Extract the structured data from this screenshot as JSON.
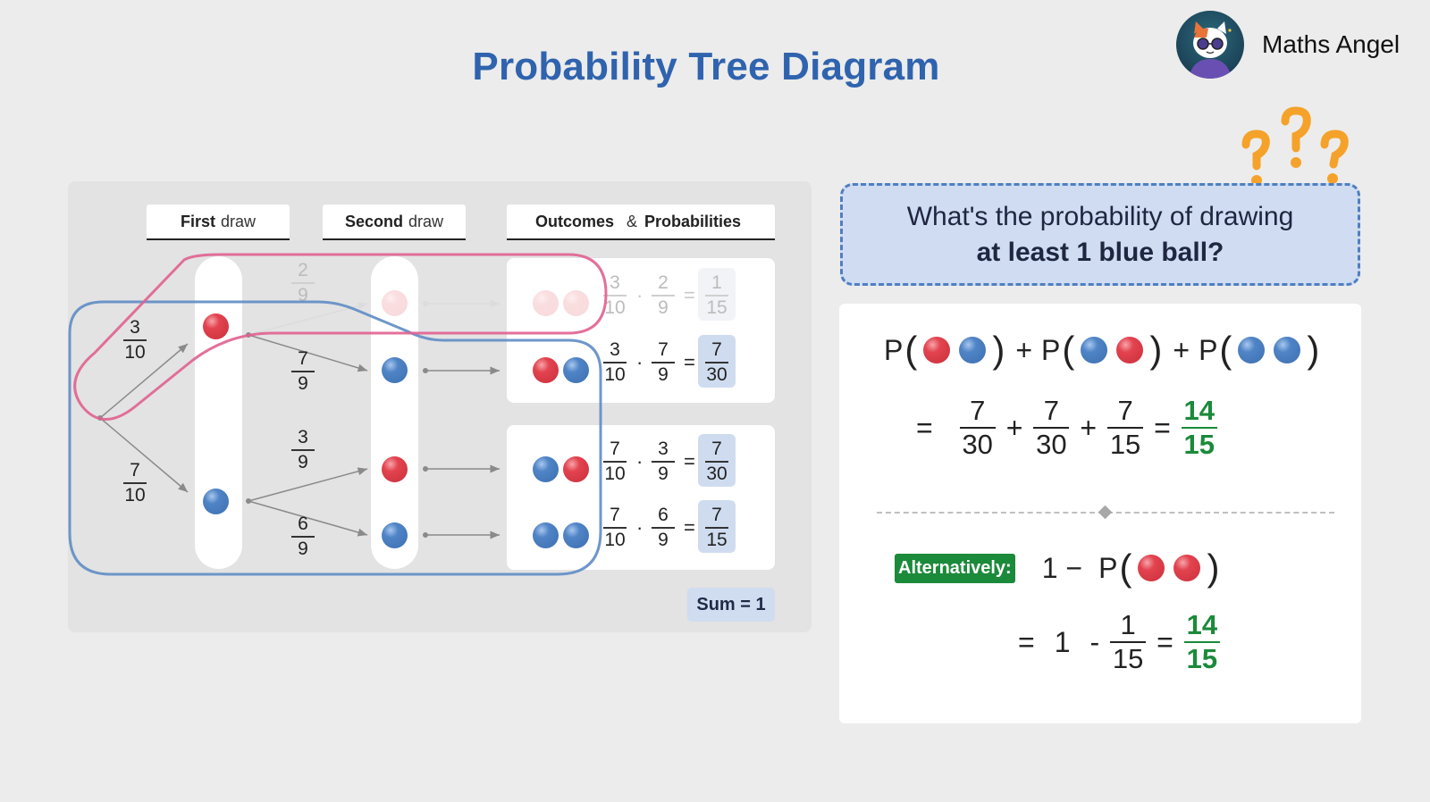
{
  "title": "Probability Tree Diagram",
  "brand": {
    "name": "Maths Angel",
    "logo_icon": "cat-with-sunglasses-avatar"
  },
  "decoration": {
    "icon": "question-marks-icon",
    "color": "#f5a22a"
  },
  "colors": {
    "accent_blue": "#2f63ae",
    "ball_red": "#e2434f",
    "ball_blue": "#4f84c6",
    "highlight_pink": "#e0608f",
    "highlight_blue": "#5e8cc4",
    "answer_green": "#1b8a3a",
    "result_bg": "#cfdcf0"
  },
  "tree": {
    "headers": [
      {
        "bold": "First",
        "rest": "draw"
      },
      {
        "bold": "Second",
        "rest": "draw"
      },
      {
        "bold": "Outcomes",
        "amp": "&",
        "bold2": "Probabilities"
      }
    ],
    "first_draw": [
      {
        "color": "red",
        "prob_num": "3",
        "prob_den": "10"
      },
      {
        "color": "blue",
        "prob_num": "7",
        "prob_den": "10"
      }
    ],
    "second_draw": [
      {
        "color": "red",
        "prob_num": "2",
        "prob_den": "9",
        "faded": true
      },
      {
        "color": "blue",
        "prob_num": "7",
        "prob_den": "9",
        "faded": false
      },
      {
        "color": "red",
        "prob_num": "3",
        "prob_den": "9",
        "faded": false
      },
      {
        "color": "blue",
        "prob_num": "6",
        "prob_den": "9",
        "faded": false
      }
    ],
    "outcomes": [
      {
        "balls": [
          "red",
          "red"
        ],
        "f1n": "3",
        "f1d": "10",
        "dot": "·",
        "f2n": "2",
        "f2d": "9",
        "eq": "=",
        "rn": "1",
        "rd": "15",
        "faded": true
      },
      {
        "balls": [
          "red",
          "blue"
        ],
        "f1n": "3",
        "f1d": "10",
        "dot": "·",
        "f2n": "7",
        "f2d": "9",
        "eq": "=",
        "rn": "7",
        "rd": "30",
        "faded": false
      },
      {
        "balls": [
          "blue",
          "red"
        ],
        "f1n": "7",
        "f1d": "10",
        "dot": "·",
        "f2n": "3",
        "f2d": "9",
        "eq": "=",
        "rn": "7",
        "rd": "30",
        "faded": false
      },
      {
        "balls": [
          "blue",
          "blue"
        ],
        "f1n": "7",
        "f1d": "10",
        "dot": "·",
        "f2n": "6",
        "f2d": "9",
        "eq": "=",
        "rn": "7",
        "rd": "15",
        "faded": false
      }
    ],
    "sum_label": "Sum = 1"
  },
  "question": {
    "line1": "What's the probability of drawing",
    "line2": "at least 1 blue ball?"
  },
  "solution": {
    "expr": {
      "p": "P",
      "open": "(",
      "close": ")",
      "plus": "+"
    },
    "line2": {
      "eq": "=",
      "plus": "+",
      "terms": [
        {
          "n": "7",
          "d": "30"
        },
        {
          "n": "7",
          "d": "30"
        },
        {
          "n": "7",
          "d": "15"
        }
      ],
      "answer": {
        "n": "14",
        "d": "15"
      }
    },
    "alt_label": "Alternatively:",
    "alt_line1": {
      "one_minus": "1 −",
      "p": "P"
    },
    "alt_line2": {
      "eq": "=",
      "one": "1",
      "minus": "-",
      "term": {
        "n": "1",
        "d": "15"
      },
      "answer": {
        "n": "14",
        "d": "15"
      }
    }
  }
}
